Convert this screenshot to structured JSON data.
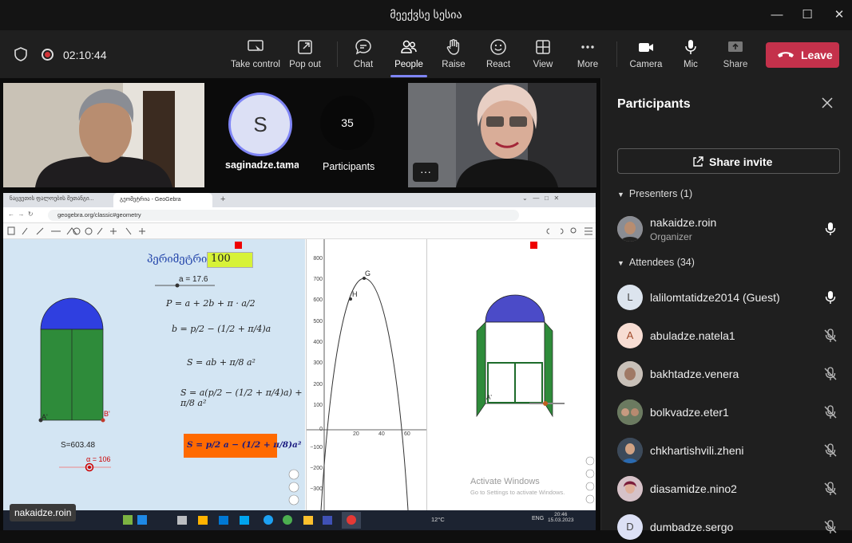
{
  "window": {
    "title": "მეექვსე სესია"
  },
  "meeting": {
    "timer": "02:10:44"
  },
  "toolbar": {
    "take_control": "Take control",
    "pop_out": "Pop out",
    "chat": "Chat",
    "people": "People",
    "raise": "Raise",
    "react": "React",
    "view": "View",
    "more": "More",
    "camera": "Camera",
    "mic": "Mic",
    "share": "Share",
    "leave": "Leave"
  },
  "stage": {
    "tile_initial": "S",
    "tile_name": "saginadze.tamaz",
    "participants_count": "35",
    "participants_label": "Participants",
    "more_dots": "···",
    "presenter_label": "nakaidze.roin"
  },
  "panel": {
    "title": "Participants",
    "share_invite": "Share invite",
    "presenters_header": "Presenters (1)",
    "attendees_header": "Attendees (34)",
    "presenters": [
      {
        "name": "nakaidze.roin",
        "role": "Organizer",
        "initial": ""
      }
    ],
    "attendees": [
      {
        "name": "lalilomtatidze2014 (Guest)",
        "initial": "L"
      },
      {
        "name": "abuladze.natela1",
        "initial": "A"
      },
      {
        "name": "bakhtadze.venera",
        "initial": ""
      },
      {
        "name": "bolkvadze.eter1",
        "initial": ""
      },
      {
        "name": "chkhartishvili.zheni",
        "initial": ""
      },
      {
        "name": "diasamidze.nino2",
        "initial": ""
      },
      {
        "name": "dumbadze.sergo",
        "initial": "D"
      }
    ]
  },
  "geogebra": {
    "tab1": "ნაცვეთის ფალოების მეთანგი...",
    "tab2": "გეომეტრია - GeoGebra",
    "new_tab": "+",
    "url": "geogebra.org/classic#geometry",
    "perimeter_label": "პერიმეტრი",
    "perimeter_value": "100",
    "slider_a": "a = 17.6",
    "f_P": "P = a + 2b + π · a/2",
    "f_b": "b = p/2 − (1/2 + π/4)a",
    "f_S1": "S = ab + π/8 a²",
    "f_S2": "S = a(p/2 − (1/2 + π/4)a) + π/8 a²",
    "f_S3": "S = p/2 a − (1/2 + π/8)a²",
    "S_value": "S=603.48",
    "alpha": "α = 106",
    "pt_A": "A'",
    "pt_B": "B'",
    "pt_G": "G",
    "pt_H": "H",
    "y_ticks": [
      "800",
      "700",
      "600",
      "500",
      "400",
      "300",
      "200",
      "100",
      "0",
      "−100",
      "−200",
      "−300"
    ],
    "x_ticks": [
      "20",
      "40",
      "60"
    ],
    "activate_title": "Activate Windows",
    "activate_sub": "Go to Settings to activate Windows.",
    "taskbar_temp": "12°C",
    "taskbar_lang": "ENG",
    "taskbar_time": "20:46",
    "taskbar_date": "15.03.2023"
  },
  "colors": {
    "accent": "#7f85f5",
    "leave": "#c4314b",
    "gg_blue": "#3333cc",
    "gg_green": "#2e7d32"
  }
}
